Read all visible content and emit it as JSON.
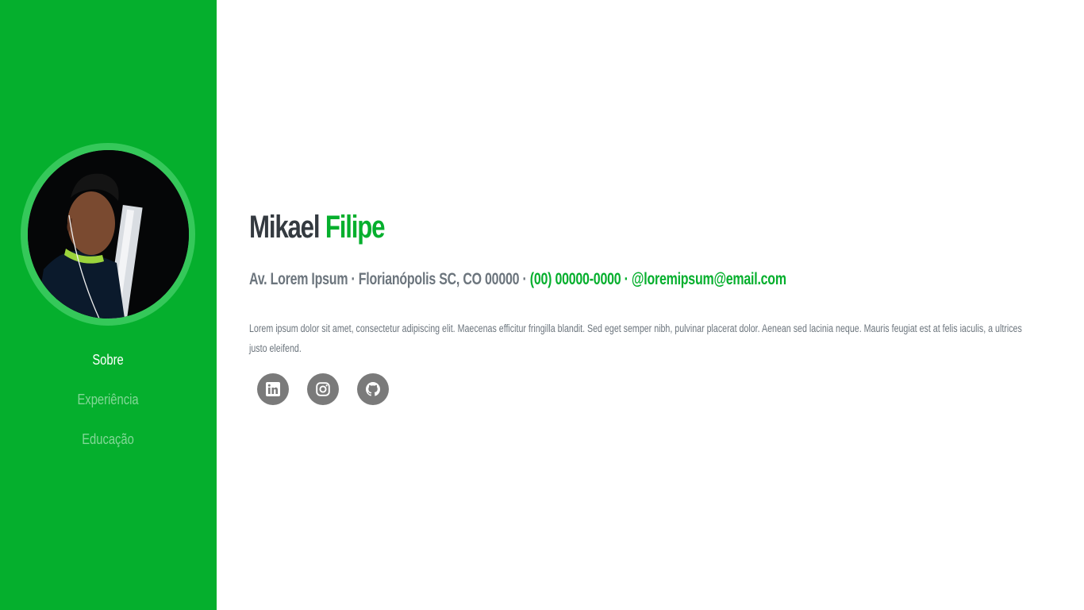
{
  "sidebar": {
    "profile_image": "profile-photo",
    "nav": [
      {
        "label": "Sobre",
        "active": true
      },
      {
        "label": "Experiência",
        "active": false
      },
      {
        "label": "Educação",
        "active": false
      }
    ]
  },
  "about": {
    "first_name": "Mikael",
    "last_name": "Filipe",
    "address": "Av. Lorem Ipsum · Florianópolis SC, CO 00000 ·",
    "phone": "(00) 00000-0000",
    "separator": "·",
    "email": "@loremipsum@email.com",
    "description_line1": "Lorem ipsum dolor sit amet, consectetur adipiscing elit. Maecenas efficitur fringilla blandit. Sed eget semper nibh, pulvinar placerat dolor. Aenean sed lacinia neque. Mauris feugiat est at felis iaculis, a ultrices",
    "description_line2": "justo eleifend."
  },
  "social": [
    {
      "icon": "linkedin-icon"
    },
    {
      "icon": "instagram-icon"
    },
    {
      "icon": "github-icon"
    }
  ],
  "colors": {
    "accent": "#05af2d",
    "sidebar_bg": "#05af2d",
    "heading": "#343a40",
    "muted": "#6c757d",
    "social_bg": "#7a7a7a"
  }
}
